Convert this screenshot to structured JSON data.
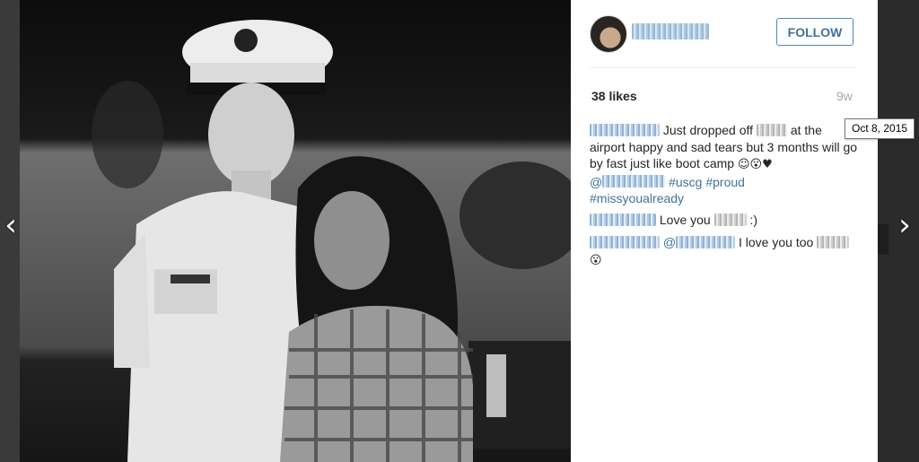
{
  "post": {
    "follow_label": "FOLLOW",
    "likes_text": "38 likes",
    "age_text": "9w",
    "timestamp_tooltip": "Oct 8, 2015"
  },
  "comments": {
    "c1_text_a": "Just dropped off",
    "c1_text_b": "at the airport happy and sad tears but 3 months will go by fast just like boot camp",
    "c1_emojis": "☺😮♥",
    "c1_at": "@",
    "c1_tag1": "#uscg",
    "c1_tag2": "#proud",
    "c1_tag3": "#missyoualready",
    "c2_text": "Love you",
    "c2_end": ":)",
    "c3_at": "@",
    "c3_text": "I love you too",
    "c3_emoji": "😮"
  },
  "nav": {
    "prev_glyph": "‹",
    "next_glyph": "›"
  },
  "colors": {
    "link": "#3f729b",
    "follow_border": "#4c88c6",
    "text": "#262626",
    "muted": "#a5a7aa"
  }
}
